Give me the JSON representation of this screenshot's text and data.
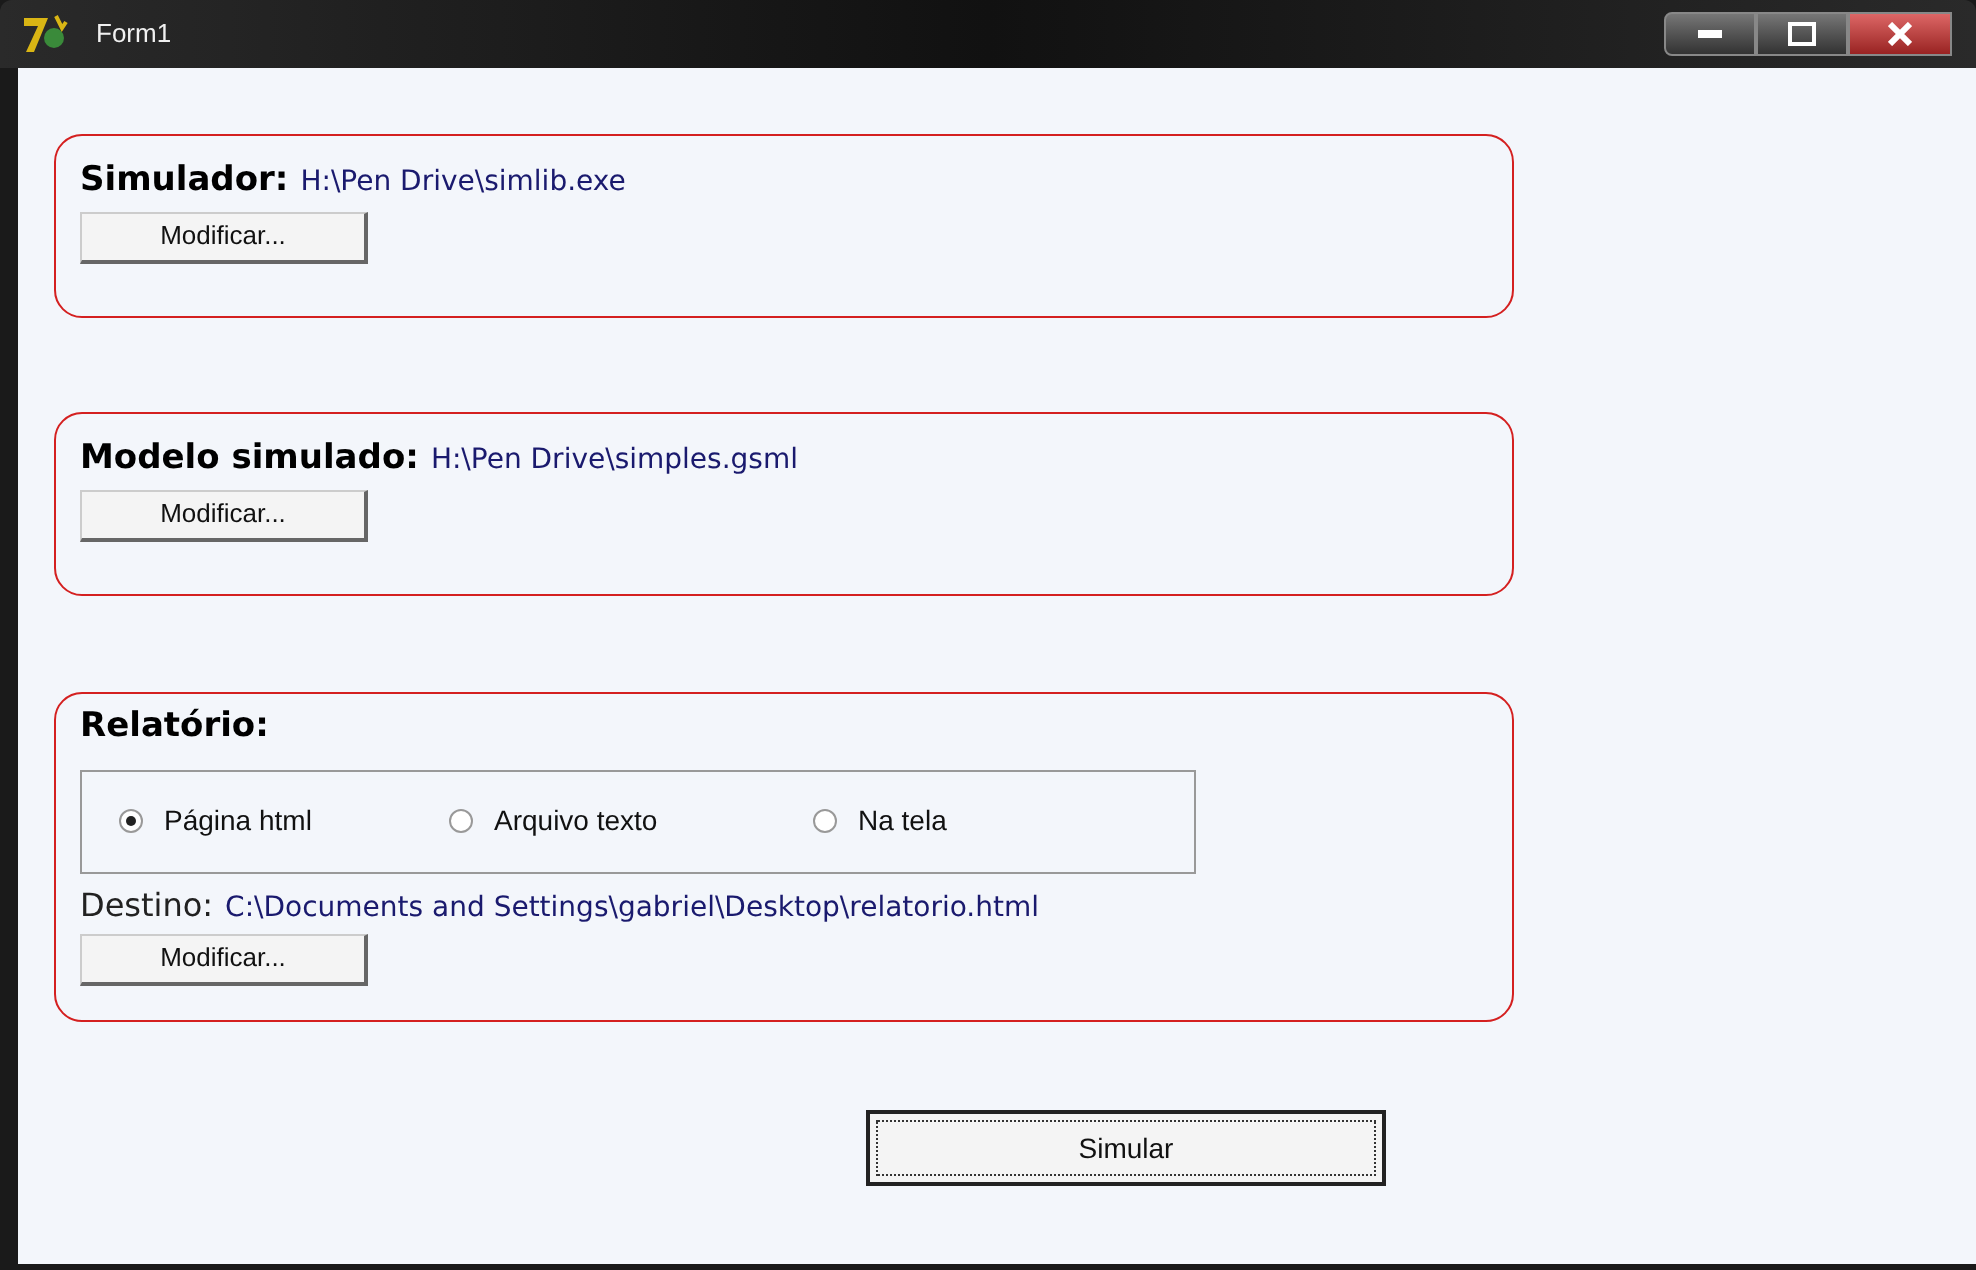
{
  "window": {
    "title": "Form1"
  },
  "sections": [
    {
      "kind": "file",
      "label": "Simulador:",
      "path": "H:\\Pen Drive\\simlib.exe",
      "button": "Modificar..."
    },
    {
      "kind": "file",
      "label": "Modelo simulado:",
      "path": "H:\\Pen Drive\\simples.gsml",
      "button": "Modificar..."
    },
    {
      "kind": "report",
      "label": "Relatório:",
      "options": [
        {
          "label": "Página html",
          "selected": true
        },
        {
          "label": "Arquivo texto",
          "selected": false
        },
        {
          "label": "Na tela",
          "selected": false
        }
      ],
      "destination_label": "Destino:",
      "path": "C:\\Documents and Settings\\gabriel\\Desktop\\relatorio.html",
      "button": "Modificar..."
    }
  ],
  "action_button": "Simular"
}
